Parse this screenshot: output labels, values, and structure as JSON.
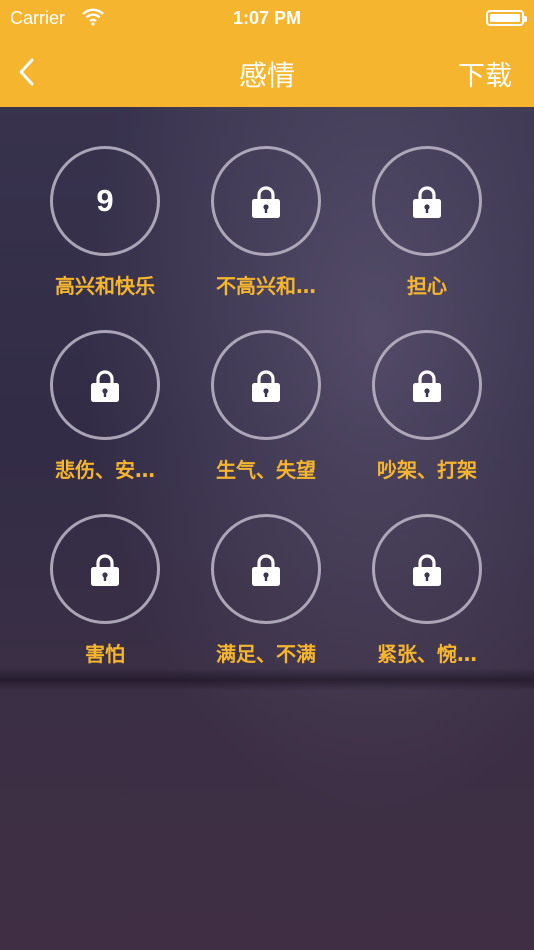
{
  "status_bar": {
    "carrier": "Carrier",
    "time": "1:07 PM"
  },
  "nav": {
    "title": "感情",
    "download_label": "下载",
    "accent_color": "#f5b52e"
  },
  "categories": [
    {
      "label": "高兴和快乐",
      "count": "9",
      "locked": false
    },
    {
      "label": "不高兴和…",
      "locked": true,
      "icon": "lock-icon"
    },
    {
      "label": "担心",
      "locked": true,
      "icon": "lock-icon"
    },
    {
      "label": "悲伤、安…",
      "locked": true,
      "icon": "lock-icon"
    },
    {
      "label": "生气、失望",
      "locked": true,
      "icon": "lock-icon"
    },
    {
      "label": "吵架、打架",
      "locked": true,
      "icon": "lock-icon"
    },
    {
      "label": "害怕",
      "locked": true,
      "icon": "lock-icon"
    },
    {
      "label": "满足、不满",
      "locked": true,
      "icon": "lock-icon"
    },
    {
      "label": "紧张、惋…",
      "locked": true,
      "icon": "lock-icon"
    }
  ]
}
